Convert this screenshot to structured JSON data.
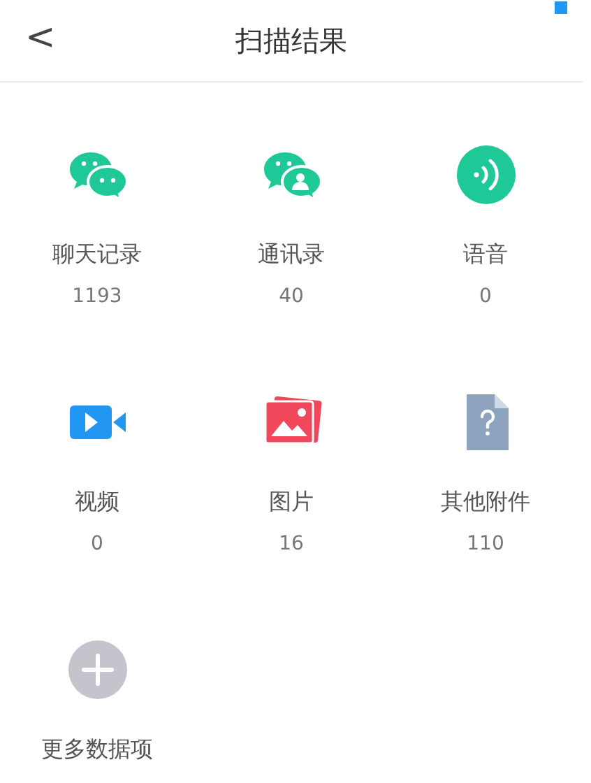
{
  "header": {
    "back": "<",
    "title": "扫描结果"
  },
  "items": [
    {
      "kind": "chat",
      "label": "聊天记录",
      "count": "1193"
    },
    {
      "kind": "contacts",
      "label": "通讯录",
      "count": "40"
    },
    {
      "kind": "voice",
      "label": "语音",
      "count": "0"
    },
    {
      "kind": "video",
      "label": "视频",
      "count": "0"
    },
    {
      "kind": "image",
      "label": "图片",
      "count": "16"
    },
    {
      "kind": "file",
      "label": "其他附件",
      "count": "110"
    },
    {
      "kind": "more",
      "label": "更多数据项"
    }
  ]
}
